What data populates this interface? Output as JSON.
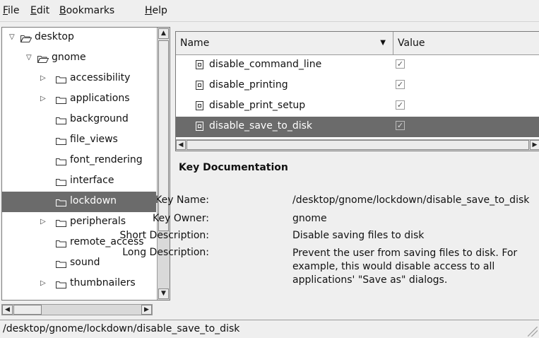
{
  "menubar": {
    "items": [
      {
        "label_u": "F",
        "label_rest": "ile"
      },
      {
        "label_u": "E",
        "label_rest": "dit"
      },
      {
        "label_u": "B",
        "label_rest": "ookmarks"
      },
      {
        "label_u": "H",
        "label_rest": "elp"
      }
    ]
  },
  "tree": {
    "items": [
      {
        "label": "desktop",
        "expander": "▽",
        "folder": "open"
      },
      {
        "label": "gnome",
        "expander": "▽",
        "folder": "open"
      },
      {
        "label": "accessibility",
        "expander": "▷",
        "folder": "closed"
      },
      {
        "label": "applications",
        "expander": "▷",
        "folder": "closed"
      },
      {
        "label": "background",
        "expander": "",
        "folder": "closed"
      },
      {
        "label": "file_views",
        "expander": "",
        "folder": "closed"
      },
      {
        "label": "font_rendering",
        "expander": "",
        "folder": "closed"
      },
      {
        "label": "interface",
        "expander": "",
        "folder": "closed"
      },
      {
        "label": "lockdown",
        "expander": "",
        "folder": "closed",
        "selected": true
      },
      {
        "label": "peripherals",
        "expander": "▷",
        "folder": "closed"
      },
      {
        "label": "remote_access",
        "expander": "",
        "folder": "closed"
      },
      {
        "label": "sound",
        "expander": "",
        "folder": "closed"
      },
      {
        "label": "thumbnailers",
        "expander": "▷",
        "folder": "closed"
      }
    ]
  },
  "list": {
    "columns": {
      "name": "Name",
      "value": "Value"
    },
    "rows": [
      {
        "key": "disable_command_line",
        "value": "✓"
      },
      {
        "key": "disable_printing",
        "value": "✓"
      },
      {
        "key": "disable_print_setup",
        "value": "✓"
      },
      {
        "key": "disable_save_to_disk",
        "value": "✓",
        "selected": true
      }
    ]
  },
  "doc": {
    "title": "Key Documentation",
    "key_name_label": "Key Name:",
    "key_name": "/desktop/gnome/lockdown/disable_save_to_disk",
    "key_owner_label": "Key Owner:",
    "key_owner": "gnome",
    "short_desc_label": "Short Description:",
    "short_desc": "Disable saving files to disk",
    "long_desc_label": "Long Description:",
    "long_desc": "Prevent the user from saving files to disk. For example, this would disable access to all applications' \"Save as\" dialogs."
  },
  "status": {
    "path": "/desktop/gnome/lockdown/disable_save_to_disk"
  },
  "colors": {
    "selection": "#6b6b6b",
    "background": "#efefef"
  }
}
